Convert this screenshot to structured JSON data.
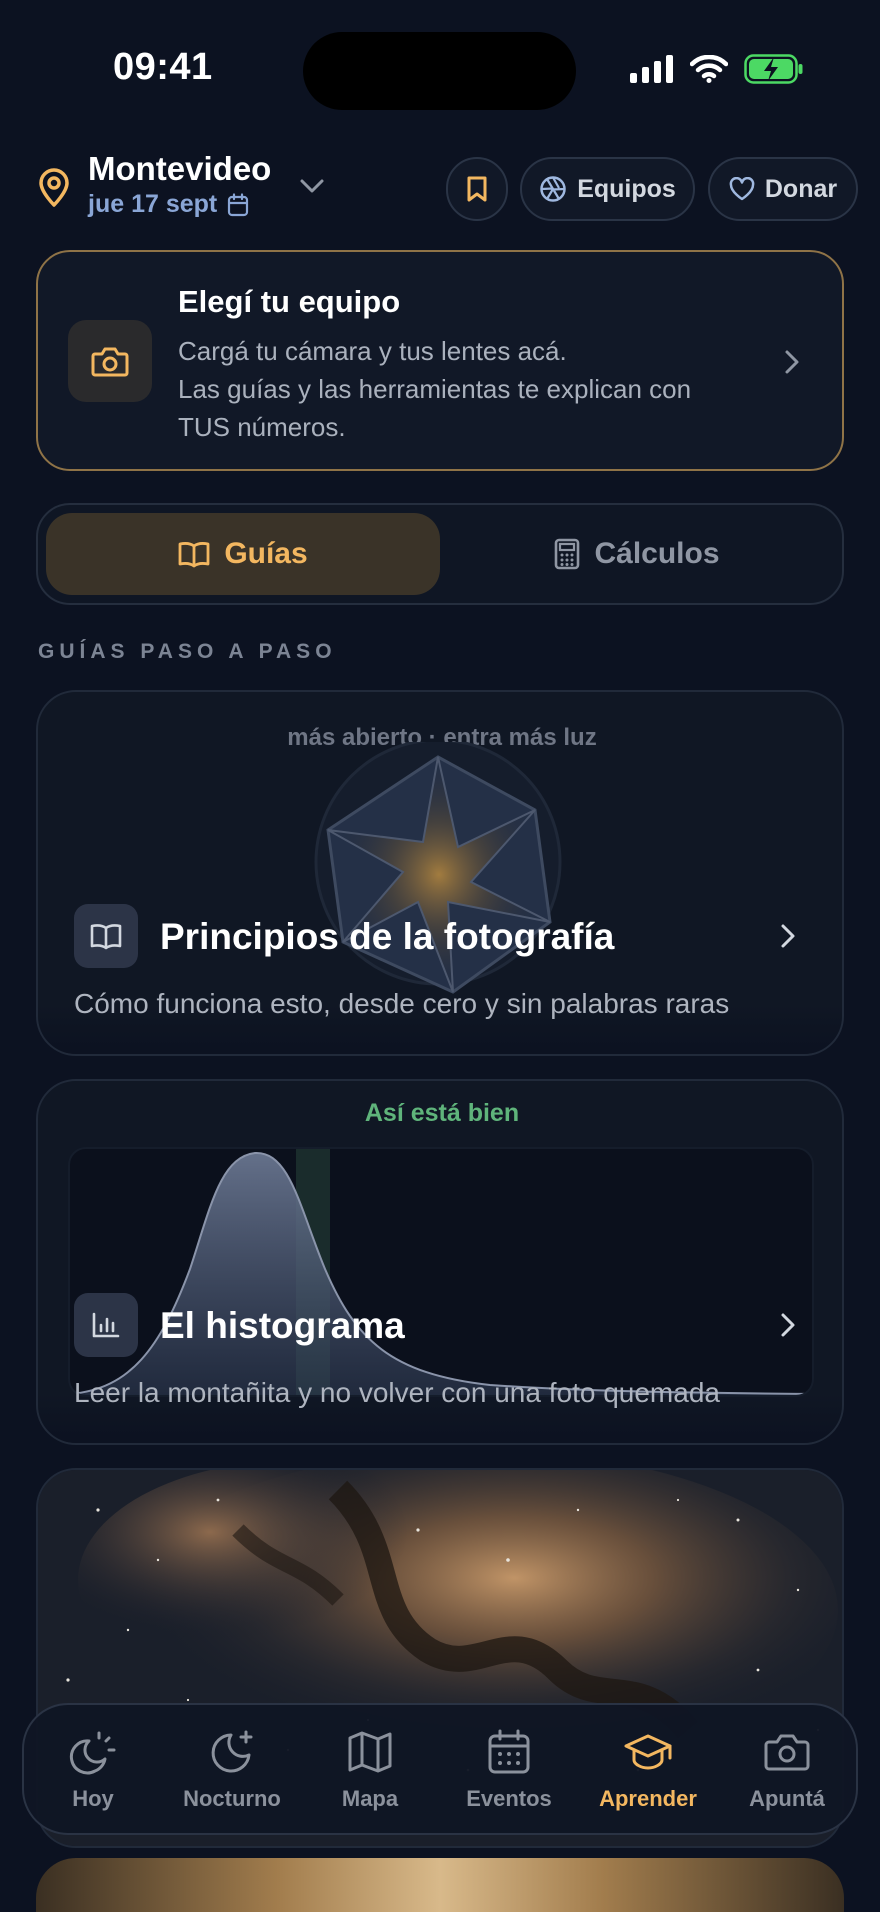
{
  "status_bar": {
    "time": "09:41"
  },
  "header": {
    "city": "Montevideo",
    "date": "jue 17 sept",
    "equipos_label": "Equipos",
    "donar_label": "Donar"
  },
  "equipo_card": {
    "title": "Elegí tu equipo",
    "line1": "Cargá tu cámara y tus lentes acá.",
    "line2": "Las guías y las herramientas te explican con",
    "line3": "TUS números."
  },
  "segmented": {
    "guias_label": "Guías",
    "calculos_label": "Cálculos",
    "active": "Guías"
  },
  "section_label": "GUÍAS PASO A PASO",
  "guides": [
    {
      "caption": "más abierto · entra más luz",
      "title": "Principios de la fotografía",
      "description": "Cómo funciona esto, desde cero y sin palabras raras",
      "icon": "book-open-icon"
    },
    {
      "caption": "Así está bien",
      "title": "El histograma",
      "description": "Leer la montañita y no volver con una foto quemada",
      "icon": "bar-chart-icon"
    },
    {
      "title": "",
      "icon": "milky-way-image"
    }
  ],
  "tabbar": {
    "items": [
      {
        "label": "Hoy",
        "icon": "sun-moon-icon"
      },
      {
        "label": "Nocturno",
        "icon": "moon-star-icon"
      },
      {
        "label": "Mapa",
        "icon": "map-icon"
      },
      {
        "label": "Eventos",
        "icon": "calendar-icon"
      },
      {
        "label": "Aprender",
        "icon": "graduation-cap-icon"
      },
      {
        "label": "Apuntá",
        "icon": "camera-icon"
      }
    ],
    "active": "Aprender"
  },
  "colors": {
    "background": "#0c1221",
    "accent": "#f3b760",
    "success": "#5fb47b",
    "date": "#8aa6d6"
  }
}
